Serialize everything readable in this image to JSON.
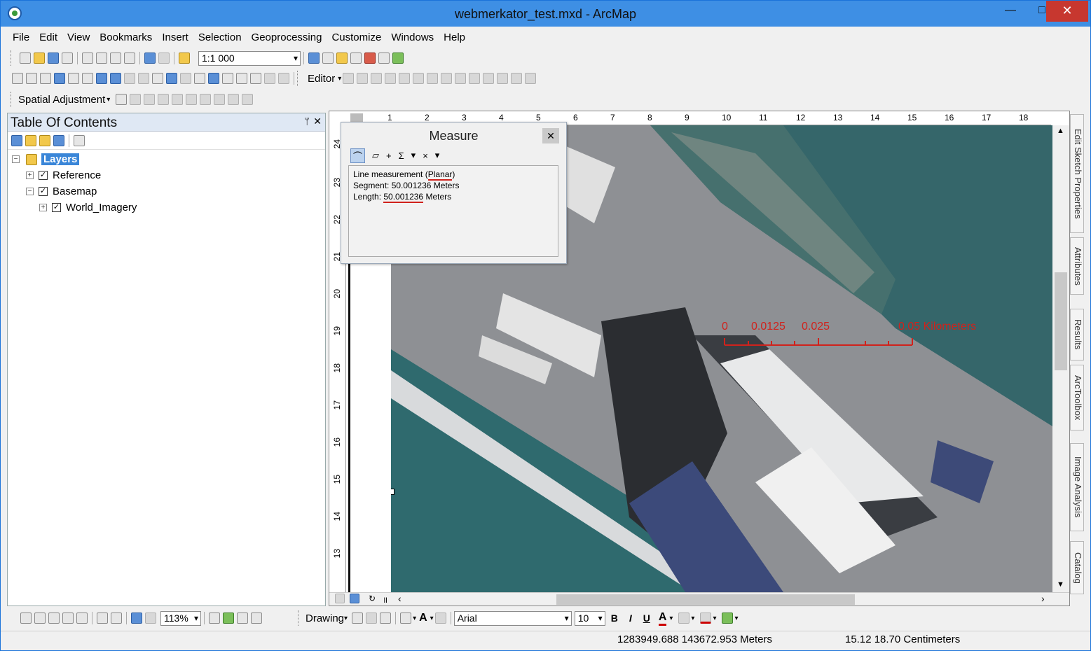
{
  "window": {
    "title": "webmerkator_test.mxd - ArcMap",
    "min": "—",
    "max": "□",
    "close": "✕"
  },
  "menu": [
    "File",
    "Edit",
    "View",
    "Bookmarks",
    "Insert",
    "Selection",
    "Geoprocessing",
    "Customize",
    "Windows",
    "Help"
  ],
  "toolbar": {
    "scale": "1:1 000",
    "editor": "Editor",
    "spatial_adjustment": "Spatial Adjustment"
  },
  "toc": {
    "title": "Table Of Contents",
    "pin": "ᛘ",
    "close": "✕",
    "layers": "Layers",
    "reference": "Reference",
    "basemap": "Basemap",
    "world_imagery": "World_Imagery"
  },
  "ruler": {
    "h": [
      "1",
      "2",
      "3",
      "4",
      "5",
      "6",
      "7",
      "8",
      "9",
      "10",
      "11",
      "12",
      "13",
      "14",
      "15",
      "16",
      "17",
      "18"
    ],
    "v": [
      "24",
      "23",
      "22",
      "21",
      "20",
      "19",
      "18",
      "17",
      "16",
      "15",
      "14",
      "13"
    ]
  },
  "measure": {
    "title": "Measure",
    "close": "✕",
    "line_prefix": "Line measurement (",
    "planar": "Planar",
    "line_suffix": ")",
    "segment_label": "Segment: ",
    "segment_value": "50.001236",
    "segment_unit": " Meters",
    "length_label": "Length: ",
    "length_value": "50.001236",
    "length_unit": " Meters",
    "tools": [
      "⌒",
      "▱",
      "+",
      "Σ",
      "▾",
      "×",
      "▾"
    ]
  },
  "scalebar": {
    "labels": [
      "0",
      "0.0125",
      "0.025",
      "0.05 Kilometers"
    ],
    "color": "#d0221c"
  },
  "sidetabs": [
    "Edit Sketch Properties",
    "Attributes",
    "Results",
    "ArcToolbox",
    "Image Analysis",
    "Catalog"
  ],
  "bottom_toolbar": {
    "zoom": "113%",
    "drawing": "Drawing",
    "font": "Arial",
    "size": "10",
    "bold": "B",
    "italic": "I",
    "underline": "U",
    "textA": "A"
  },
  "status": {
    "coords": "1283949.688  143672.953 Meters",
    "page": "15.12  18.70 Centimeters"
  }
}
